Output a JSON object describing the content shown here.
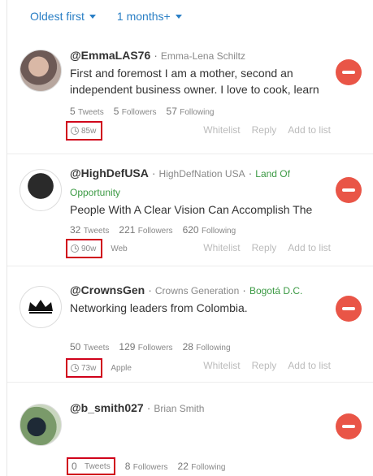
{
  "filters": {
    "sort": "Oldest first",
    "period": "1 months+"
  },
  "colors": {
    "accent": "#2a7fc5",
    "remove": "#e95547",
    "location": "#3c9a44",
    "highlight": "#d0021b"
  },
  "action_labels": {
    "whitelist": "Whitelist",
    "reply": "Reply",
    "add_to_list": "Add to list"
  },
  "stat_labels": {
    "tweets": "Tweets",
    "followers": "Followers",
    "following": "Following"
  },
  "users": [
    {
      "handle": "@EmmaLAS76",
      "name": "Emma-Lena Schiltz",
      "location": "",
      "bio": "First and foremost I am a mother, second an",
      "bio2": "independent business owner. I love to cook, learn",
      "tweets": "5",
      "followers": "5",
      "following": "57",
      "age": "85w",
      "source": ""
    },
    {
      "handle": "@HighDefUSA",
      "name": "HighDefNation USA",
      "location": "Land Of",
      "location2": "Opportunity",
      "bio": "People With A Clear Vision Can Accomplish The",
      "tweets": "32",
      "followers": "221",
      "following": "620",
      "age": "90w",
      "source": "Web"
    },
    {
      "handle": "@CrownsGen",
      "name": "Crowns Generation",
      "location": "Bogotá D.C.",
      "bio": "Networking leaders from Colombia.",
      "tweets": "50",
      "followers": "129",
      "following": "28",
      "age": "73w",
      "source": "Apple"
    },
    {
      "handle": "@b_smith027",
      "name": "Brian Smith",
      "location": "",
      "bio": "",
      "tweets": "0",
      "followers": "8",
      "following": "22"
    }
  ]
}
